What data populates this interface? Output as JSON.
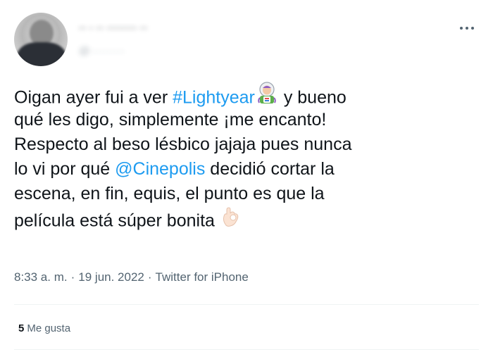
{
  "tweet": {
    "author": {
      "display_name": "·· · ·· ········ ··",
      "username": "@··········"
    },
    "text": {
      "line1_before": "Oigan ayer fui a ver ",
      "hashtag": "#Lightyear",
      "emoji_buzz": "buzz-lightyear-emoji",
      "line1_after": " y bueno",
      "line2": "qué les digo, simplemente ¡me encanto!",
      "line3": "Respecto al beso lésbico jajaja pues nunca",
      "line4_before": "lo vi por qué ",
      "mention": "@Cinepolis",
      "line4_after": " decidió cortar la",
      "line5": "escena, en fin, equis, el punto es que la",
      "line6": "película está súper bonita",
      "emoji_ok": "ok-hand-emoji"
    },
    "meta": {
      "time": "8:33 a. m.",
      "separator": "·",
      "date": "19 jun. 2022",
      "source": "Twitter for iPhone"
    },
    "likes": {
      "count": "5",
      "label": "Me gusta"
    },
    "colors": {
      "link": "#1d9bf0",
      "text": "#0f1419",
      "secondary": "#536471",
      "divider": "#eff3f4"
    }
  }
}
